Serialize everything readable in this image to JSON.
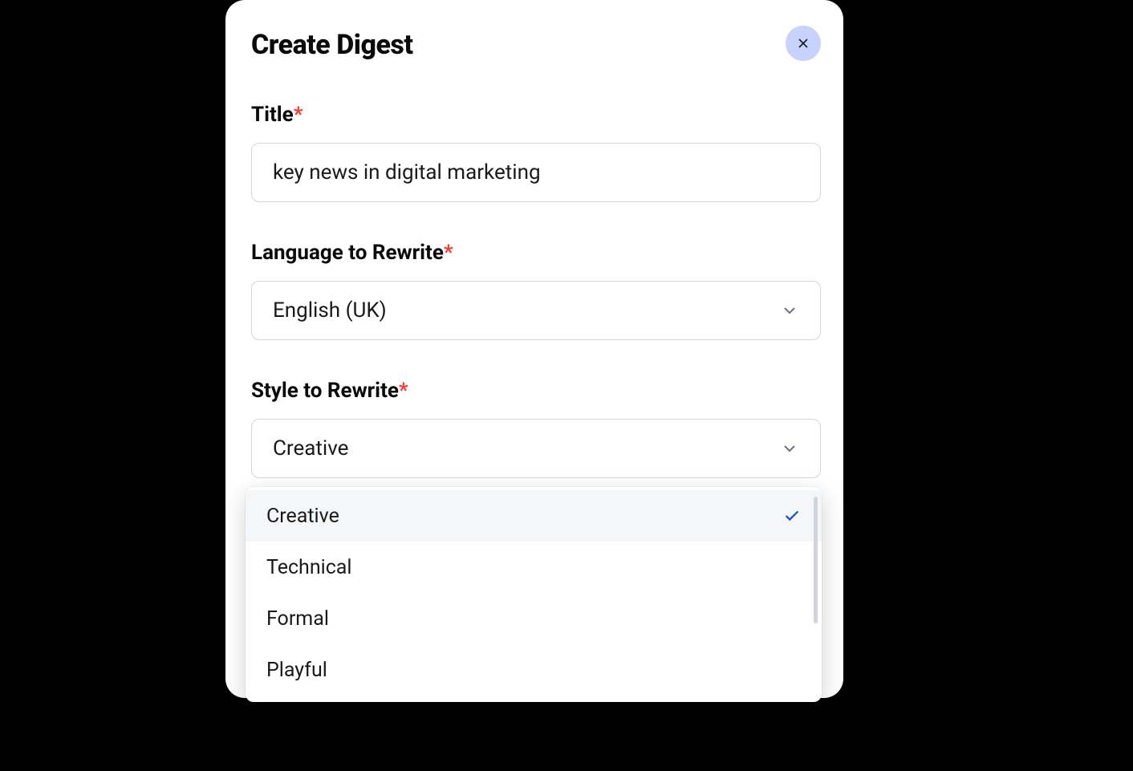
{
  "modal": {
    "title": "Create Digest",
    "fields": {
      "title": {
        "label": "Title",
        "value": "key news in digital marketing"
      },
      "language": {
        "label": "Language to Rewrite",
        "value": "English (UK)"
      },
      "style": {
        "label": "Style to Rewrite",
        "value": "Creative",
        "options": [
          "Creative",
          "Technical",
          "Formal",
          "Playful"
        ],
        "selected": "Creative"
      }
    }
  }
}
